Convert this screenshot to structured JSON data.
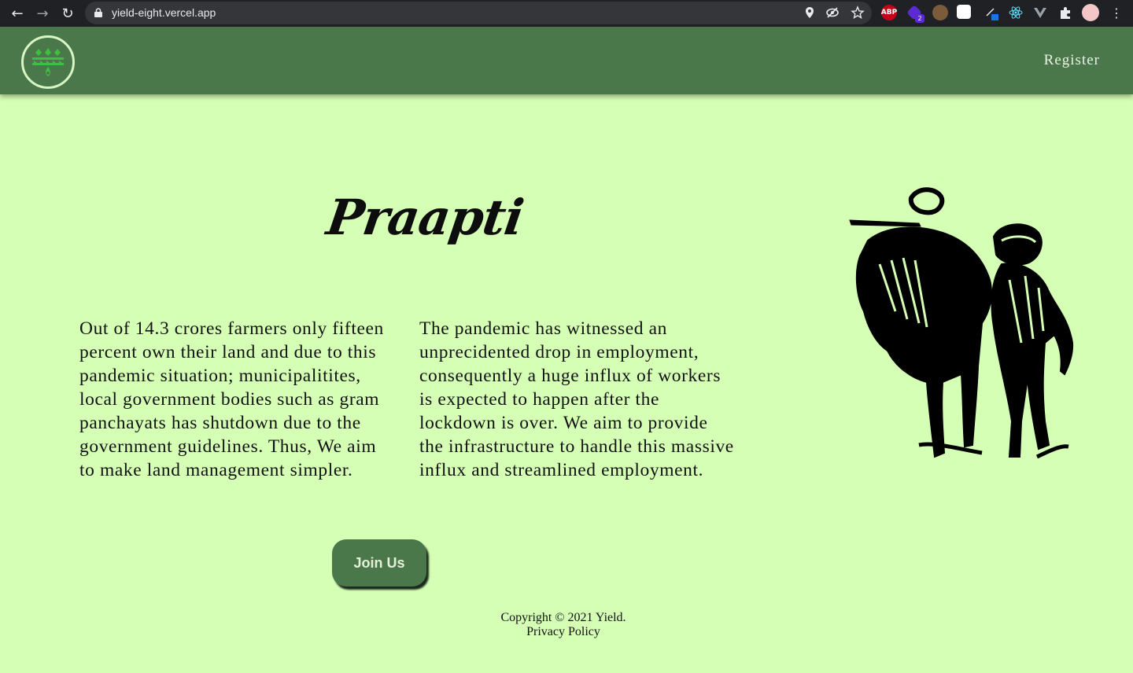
{
  "browser": {
    "url": "yield-eight.vercel.app",
    "back_icon": "←",
    "forward_icon": "→",
    "reload_icon": "↻",
    "extensions": [
      {
        "name": "abp",
        "label": "ABP",
        "color": "#c4001a"
      },
      {
        "name": "badge-2",
        "label": "2",
        "color": "#5b2bd1"
      }
    ]
  },
  "header": {
    "register_label": "Register",
    "header_color": "#4a784a"
  },
  "main": {
    "title": "Praapti",
    "paragraph_left": "Out of 14.3 crores farmers only fifteen percent own their land and due to this pandemic situation; municipalitites, local government bodies such as gram panchayats has shutdown due to the government guidelines. Thus, We aim to make land management simpler.",
    "paragraph_right": "The pandemic has witnessed an unprecidented drop in employment, consequently a huge influx of workers is expected to happen after the lockdown is over. We aim to provide the infrastructure to handle this massive influx and streamlined employment.",
    "join_label": "Join Us",
    "background_color": "#d5ffb5"
  },
  "footer": {
    "copyright": "Copyright © 2021 Yield.",
    "privacy": "Privacy Policy"
  }
}
